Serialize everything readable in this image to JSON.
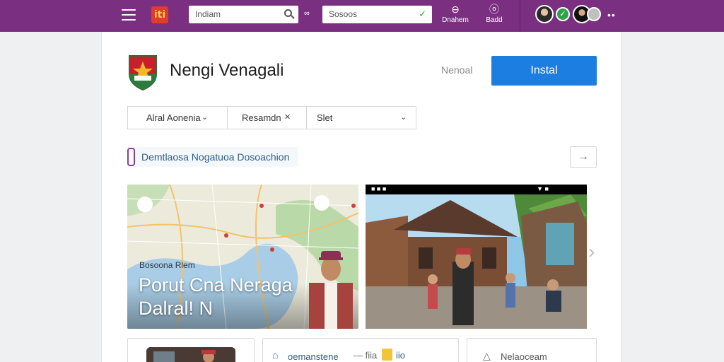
{
  "topbar": {
    "menu_icon": "hamburger-icon",
    "logo_text": "iti",
    "search1": {
      "value": "Indiam",
      "icon": "search-icon"
    },
    "separator_glyph": "∞",
    "search2": {
      "value": "Sosoos",
      "icon": "mic-icon"
    },
    "items": [
      {
        "icon": "⊖",
        "label": "Dnahem"
      },
      {
        "icon": "ⓞ",
        "label": "Badd"
      }
    ],
    "more_glyph": "••",
    "accent_color": "#7a2f80"
  },
  "app": {
    "title": "Nengi Venagali",
    "secondary_link": "Nenoal",
    "install_label": "Instal",
    "install_color": "#1b7ee0"
  },
  "filters": [
    {
      "label": "Alral Aonenia",
      "chevron": "⌄"
    },
    {
      "label": "Resamdn",
      "chevron": "✕"
    },
    {
      "label": "Slet",
      "chevron": "⌄"
    }
  ],
  "section": {
    "label": "Demtlaosa Nogatuoa Dosoachion",
    "arrow": "→"
  },
  "media": {
    "map": {
      "place_label": "Bosoona Rlem",
      "caption_line1": "Porut Cna Neraga",
      "caption_line2": "Dalral! N"
    },
    "photo": {
      "status_left": "■ ■ ■",
      "status_right": "▼ ■"
    },
    "next_glyph": "›"
  },
  "bottom": {
    "tile2": {
      "label": "oemanstene",
      "dash": "— fiia",
      "extra": "iio"
    },
    "tile3": {
      "label": "Nelaoceam"
    }
  }
}
